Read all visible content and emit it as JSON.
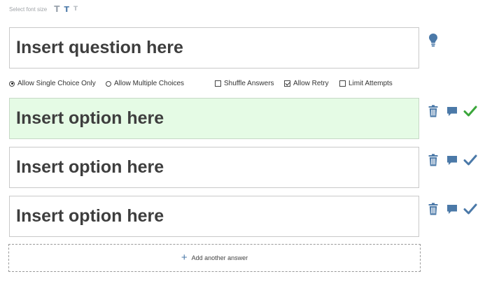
{
  "font_size": {
    "label": "Select font size",
    "sizes": [
      {
        "name": "large",
        "glyph": "T"
      },
      {
        "name": "medium",
        "glyph": "T"
      },
      {
        "name": "small",
        "glyph": "T"
      }
    ]
  },
  "question": {
    "placeholder": "Insert question here"
  },
  "answer_mode": {
    "single_label": "Allow Single Choice Only",
    "single_selected": true,
    "multiple_label": "Allow Multiple Choices",
    "multiple_selected": false
  },
  "settings": {
    "shuffle_label": "Shuffle Answers",
    "shuffle_checked": false,
    "retry_label": "Allow Retry",
    "retry_checked": true,
    "limit_label": "Limit Attempts",
    "limit_checked": false
  },
  "options": [
    {
      "text": "Insert option here",
      "correct": true
    },
    {
      "text": "Insert option here",
      "correct": false
    },
    {
      "text": "Insert option here",
      "correct": false
    }
  ],
  "add_answer": {
    "icon": "+",
    "label": "Add another answer"
  },
  "icons": {
    "hint": "lightbulb-icon",
    "delete": "trash-icon",
    "feedback": "comment-icon",
    "mark_correct": "check-icon"
  },
  "colors": {
    "accent": "#4b79a8",
    "correct_check": "#3aa63a",
    "correct_bg": "#e5fbe5"
  }
}
